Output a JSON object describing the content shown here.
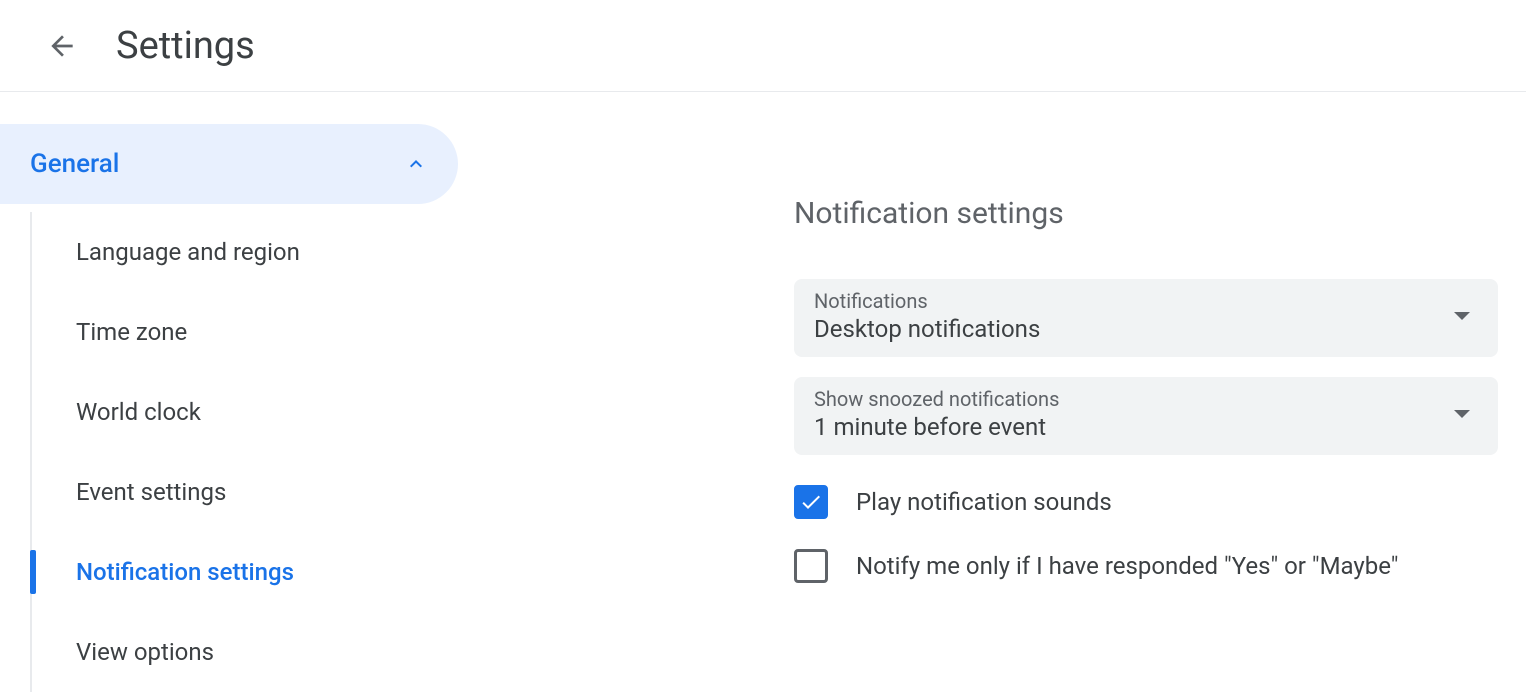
{
  "header": {
    "title": "Settings"
  },
  "sidebar": {
    "group_label": "General",
    "items": [
      {
        "label": "Language and region",
        "active": false
      },
      {
        "label": "Time zone",
        "active": false
      },
      {
        "label": "World clock",
        "active": false
      },
      {
        "label": "Event settings",
        "active": false
      },
      {
        "label": "Notification settings",
        "active": true
      },
      {
        "label": "View options",
        "active": false
      }
    ]
  },
  "main": {
    "section_title": "Notification settings",
    "selects": [
      {
        "label": "Notifications",
        "value": "Desktop notifications"
      },
      {
        "label": "Show snoozed notifications",
        "value": "1 minute before event"
      }
    ],
    "checkboxes": [
      {
        "label": "Play notification sounds",
        "checked": true
      },
      {
        "label": "Notify me only if I have responded \"Yes\" or \"Maybe\"",
        "checked": false
      }
    ]
  }
}
